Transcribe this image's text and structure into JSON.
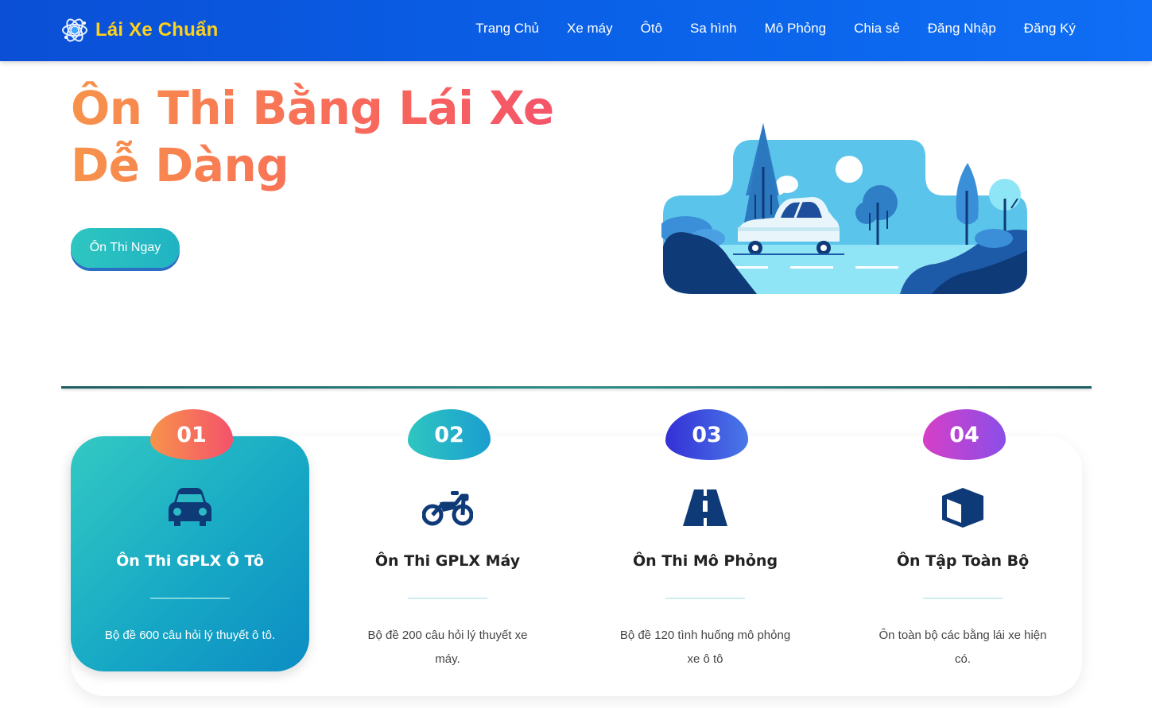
{
  "brand": {
    "name": "Lái Xe Chuẩn",
    "color": "#ffd21a"
  },
  "nav": {
    "items": [
      "Trang Chủ",
      "Xe máy",
      "Ôtô",
      "Sa hình",
      "Mô Phỏng",
      "Chia sẻ",
      "Đăng Nhập",
      "Đăng Ký"
    ]
  },
  "hero": {
    "title_line1": "Ôn Thi Bằng Lái Xe",
    "title_line2": "Dễ Dàng",
    "cta_label": "Ôn Thi Ngay"
  },
  "features": [
    {
      "number": "01",
      "icon": "car-icon",
      "title": "Ôn Thi GPLX Ô Tô",
      "desc": "Bộ đề 600 câu hỏi lý thuyết ô tô.",
      "badge_color": "#f8805a",
      "active": true
    },
    {
      "number": "02",
      "icon": "motorcycle-icon",
      "title": "Ôn Thi GPLX Máy",
      "desc": "Bộ đề 200 câu hỏi lý thuyết xe máy.",
      "badge_color": "#1fb6c4",
      "active": false
    },
    {
      "number": "03",
      "icon": "road-icon",
      "title": "Ôn Thi Mô Phỏng",
      "desc": "Bộ đề 120 tình huống mô phỏng xe ô tô",
      "badge_color": "#3b3fd9",
      "active": false
    },
    {
      "number": "04",
      "icon": "box-icon",
      "title": "Ôn Tập Toàn Bộ",
      "desc": "Ôn toàn bộ các bằng lái xe hiện có.",
      "badge_color": "#c64ce0",
      "active": false
    }
  ],
  "colors": {
    "nav_bg": "#0a5ce4",
    "accent_teal": "#2ec6c0",
    "icon_navy": "#123b8c"
  }
}
